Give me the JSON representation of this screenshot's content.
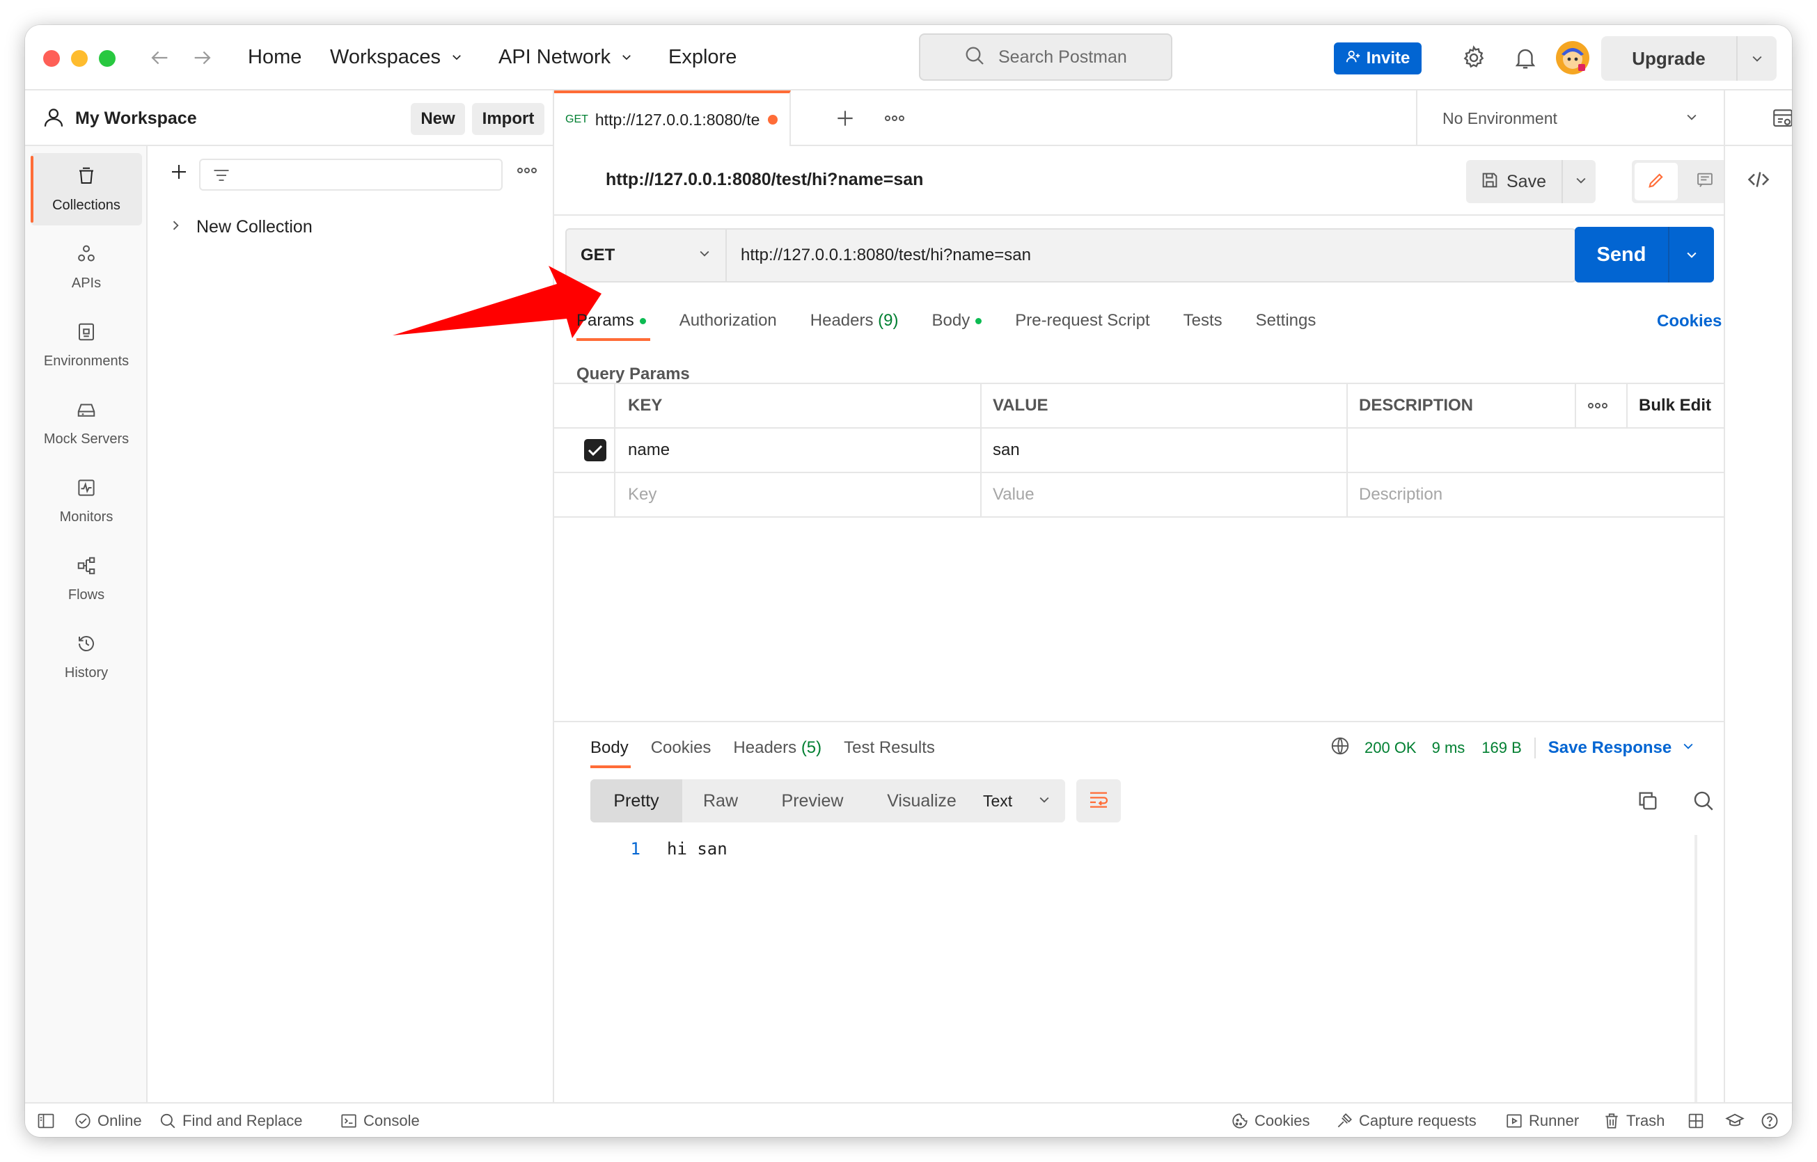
{
  "topbar": {
    "nav": {
      "home": "Home",
      "workspaces": "Workspaces",
      "api_network": "API Network",
      "explore": "Explore"
    },
    "search_placeholder": "Search Postman",
    "invite_label": "Invite",
    "upgrade_label": "Upgrade"
  },
  "workspace": {
    "title": "My Workspace",
    "new_label": "New",
    "import_label": "Import"
  },
  "leftnav": {
    "items": [
      {
        "label": "Collections",
        "icon": "collections-icon"
      },
      {
        "label": "APIs",
        "icon": "apis-icon"
      },
      {
        "label": "Environments",
        "icon": "environments-icon"
      },
      {
        "label": "Mock Servers",
        "icon": "mock-servers-icon"
      },
      {
        "label": "Monitors",
        "icon": "monitors-icon"
      },
      {
        "label": "Flows",
        "icon": "flows-icon"
      },
      {
        "label": "History",
        "icon": "history-icon"
      }
    ]
  },
  "collections": {
    "items": [
      {
        "label": "New Collection"
      }
    ]
  },
  "tab": {
    "method": "GET",
    "title": "http://127.0.0.1:8080/te"
  },
  "environment": {
    "selected": "No Environment"
  },
  "request": {
    "name": "http://127.0.0.1:8080/test/hi?name=san",
    "save_label": "Save",
    "method": "GET",
    "url": "http://127.0.0.1:8080/test/hi?name=san",
    "send_label": "Send",
    "tabs": {
      "params": "Params",
      "authorization": "Authorization",
      "headers": "Headers",
      "headers_count": "(9)",
      "body": "Body",
      "prerequest": "Pre-request Script",
      "tests": "Tests",
      "settings": "Settings",
      "cookies": "Cookies"
    },
    "query_params_title": "Query Params",
    "table": {
      "headers": {
        "key": "KEY",
        "value": "VALUE",
        "description": "DESCRIPTION",
        "bulk_edit": "Bulk Edit"
      },
      "rows": [
        {
          "checked": true,
          "key": "name",
          "value": "san",
          "description": ""
        }
      ],
      "placeholders": {
        "key": "Key",
        "value": "Value",
        "description": "Description"
      }
    }
  },
  "response": {
    "tabs": {
      "body": "Body",
      "cookies": "Cookies",
      "headers": "Headers",
      "headers_count": "(5)",
      "test_results": "Test Results"
    },
    "status": "200 OK",
    "time": "9 ms",
    "size": "169 B",
    "save_response": "Save Response",
    "formats": {
      "pretty": "Pretty",
      "raw": "Raw",
      "preview": "Preview",
      "visualize": "Visualize"
    },
    "type": "Text",
    "lines": [
      {
        "number": "1",
        "text": "hi san"
      }
    ]
  },
  "statusbar": {
    "online": "Online",
    "find_replace": "Find and Replace",
    "console": "Console",
    "cookies": "Cookies",
    "capture": "Capture requests",
    "runner": "Runner",
    "trash": "Trash"
  },
  "colors": {
    "accent": "#ff6c37",
    "primary": "#0265d2",
    "success": "#007f31",
    "annotation_arrow": "#ff0000"
  }
}
